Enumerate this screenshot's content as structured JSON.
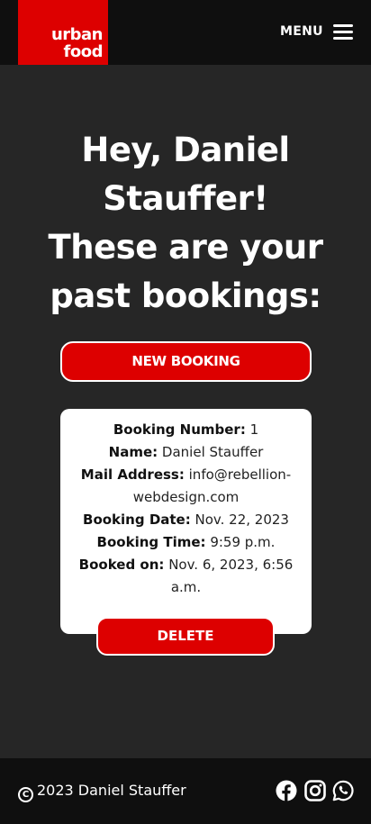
{
  "header": {
    "logo_line1": "urban",
    "logo_line2": "food",
    "menu_label": "MENU",
    "menu_icon": "hamburger-icon"
  },
  "main": {
    "heading_line1": "Hey, Daniel",
    "heading_line2": "Stauffer!",
    "heading_line3": "These are your",
    "heading_line4": "past bookings:",
    "new_booking_label": "NEW BOOKING"
  },
  "booking": {
    "number_label": "Booking Number:",
    "number_value": "1",
    "name_label": "Name:",
    "name_value": "Daniel Stauffer",
    "mail_label": "Mail Address:",
    "mail_value_part1": "info@rebellion-",
    "mail_value_part2": "webdesign.com",
    "date_label": "Booking Date:",
    "date_value": "Nov. 22, 2023",
    "time_label": "Booking Time:",
    "time_value": "9:59 p.m.",
    "booked_label": "Booked on:",
    "booked_value_part1": "Nov. 6, 2023, 6:56",
    "booked_value_part2": "a.m.",
    "delete_label": "DELETE"
  },
  "footer": {
    "copyright": "2023 Daniel Stauffer",
    "icons": [
      "facebook-icon",
      "instagram-icon",
      "whatsapp-icon"
    ]
  },
  "colors": {
    "brand_red": "#dd0000",
    "background": "#262626",
    "header_bg": "#0f0f0f"
  }
}
